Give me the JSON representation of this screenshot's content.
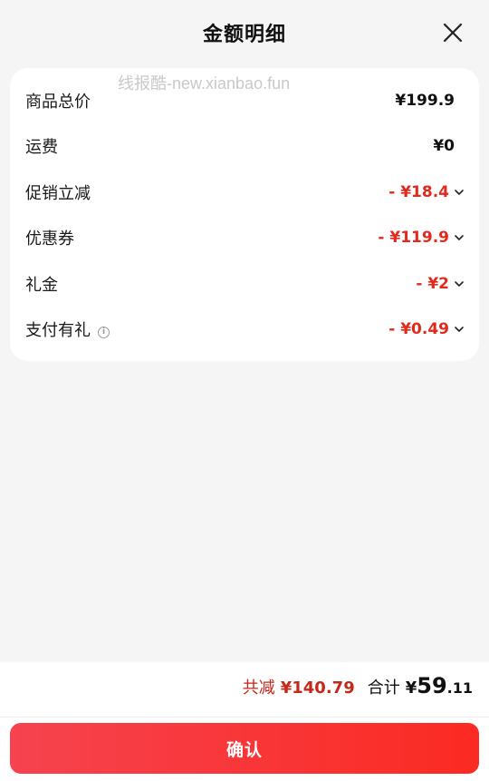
{
  "header": {
    "title": "金额明细",
    "close_icon": "close-icon"
  },
  "watermark": "线报酷-new.xianbao.fun",
  "details": {
    "rows": [
      {
        "label": "商品总价",
        "value": "¥199.9",
        "discount": false
      },
      {
        "label": "运费",
        "value": "¥0",
        "discount": false
      },
      {
        "label": "促销立减",
        "value": "- ¥18.4",
        "discount": true
      },
      {
        "label": "优惠券",
        "value": "- ¥119.9",
        "discount": true
      },
      {
        "label": "礼金",
        "value": "- ¥2",
        "discount": true
      },
      {
        "label": "支付有礼",
        "value": "- ¥0.49",
        "discount": true,
        "info_icon": "ⓘ"
      }
    ]
  },
  "footer": {
    "saved_label": "共减",
    "saved_amount": "¥140.79",
    "total_label": "合计",
    "total_symbol": "¥",
    "total_integer": "59",
    "total_decimal": ".11",
    "confirm_label": "确认"
  },
  "colors": {
    "discount_red": "#e02a1e",
    "button_gradient_start": "#f6434f",
    "button_gradient_end": "#fb2a22",
    "background": "#f5f5f5"
  }
}
